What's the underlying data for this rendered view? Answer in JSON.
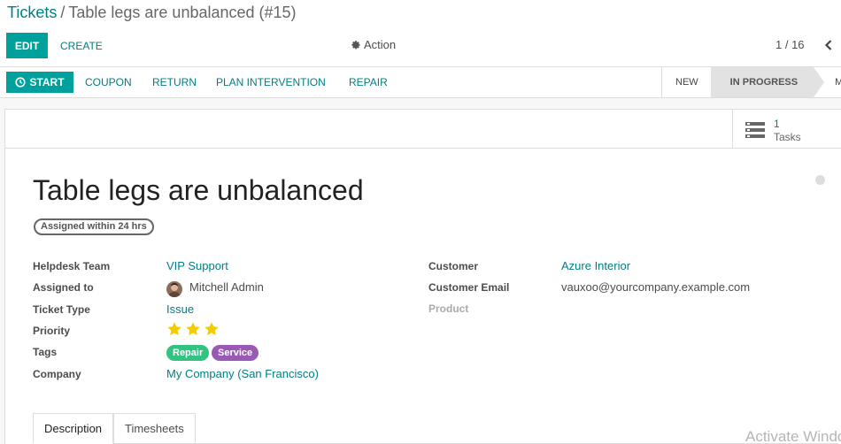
{
  "breadcrumb": {
    "parent": "Tickets",
    "separator": "/",
    "current": "Table legs are unbalanced (#15)"
  },
  "toolbar": {
    "edit_label": "EDIT",
    "create_label": "CREATE",
    "action_label": "Action",
    "pager": "1 / 16"
  },
  "header_buttons": {
    "start": "START",
    "coupon": "COUPON",
    "return": "RETURN",
    "plan_intervention": "PLAN INTERVENTION",
    "repair": "REPAIR"
  },
  "stages": [
    {
      "label": "NEW"
    },
    {
      "label": "IN PROGRESS",
      "active": true
    },
    {
      "label": "MORE"
    }
  ],
  "smart_button": {
    "value": "1",
    "label": "Tasks"
  },
  "ticket": {
    "title": "Table legs are unbalanced",
    "sla_badge": "Assigned within 24 hrs",
    "fields_left": {
      "team_label": "Helpdesk Team",
      "team_value": "VIP Support",
      "assigned_label": "Assigned to",
      "assigned_value": "Mitchell Admin",
      "type_label": "Ticket Type",
      "type_value": "Issue",
      "priority_label": "Priority",
      "priority_stars": 3,
      "tags_label": "Tags",
      "company_label": "Company",
      "company_value": "My Company (San Francisco)"
    },
    "fields_right": {
      "customer_label": "Customer",
      "customer_value": "Azure Interior",
      "email_label": "Customer Email",
      "email_value": "vauxoo@yourcompany.example.com",
      "product_label": "Product"
    },
    "tags": [
      {
        "label": "Repair",
        "color": "#30c381"
      },
      {
        "label": "Service",
        "color": "#9b59b6"
      }
    ]
  },
  "tabs": {
    "description": "Description",
    "timesheets": "Timesheets"
  },
  "watermark": "Activate Windows",
  "colors": {
    "primary": "#00a09d",
    "link": "#017e84",
    "star": "#f3cc00"
  }
}
